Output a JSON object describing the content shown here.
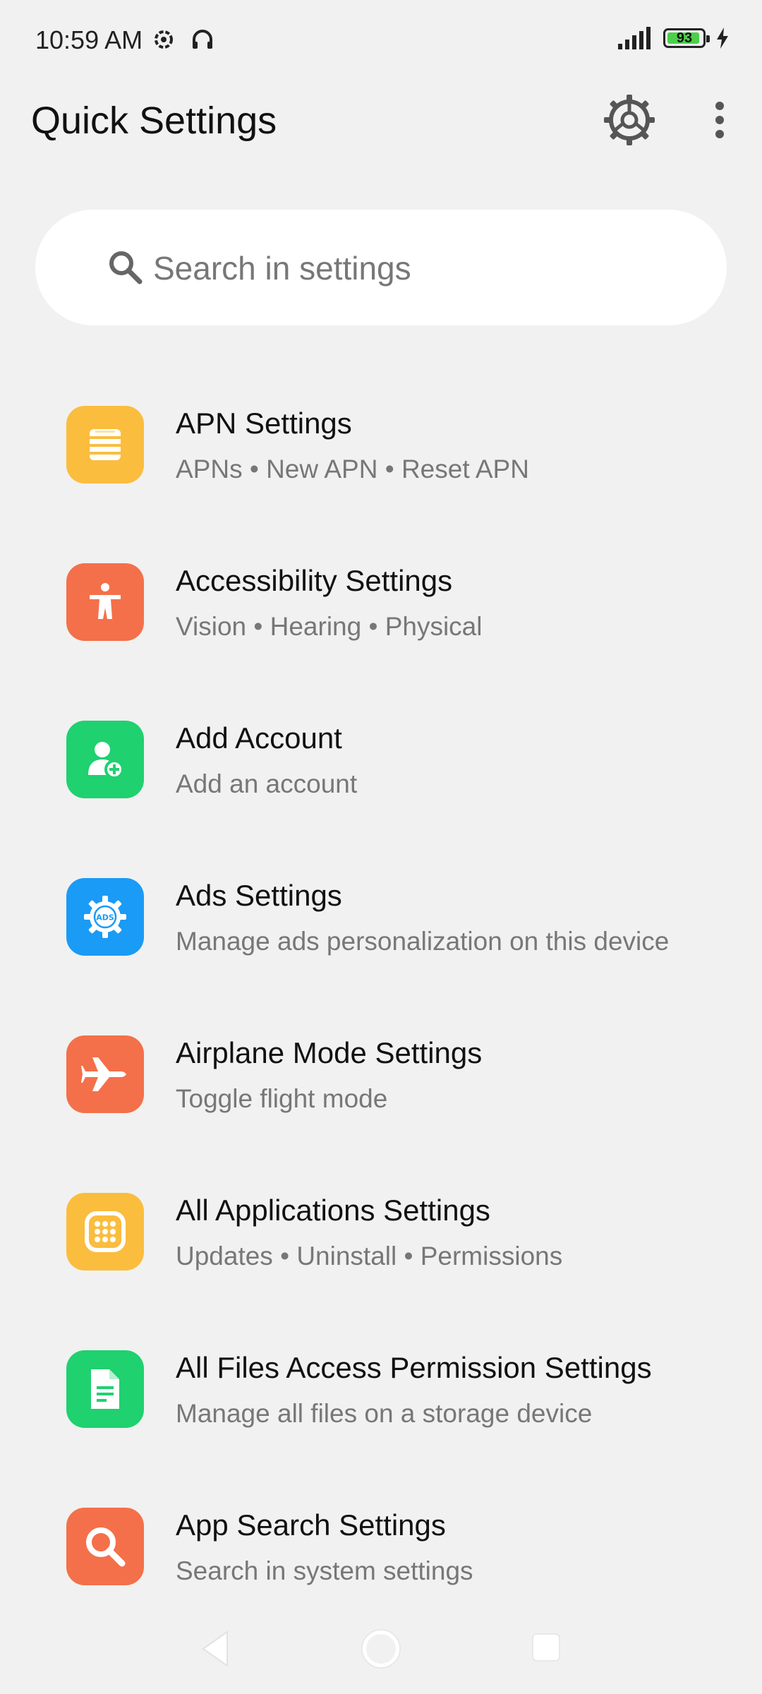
{
  "status_bar": {
    "time": "10:59 AM",
    "battery_level": "93",
    "battery_percent": 93
  },
  "header": {
    "title": "Quick Settings"
  },
  "search": {
    "placeholder": "Search in settings"
  },
  "colors": {
    "background": "#f1f1f1",
    "search_bg": "#ffffff",
    "yellow": "#fbbd3e",
    "orange": "#f4704a",
    "green": "#1fd16f",
    "blue": "#1a9bf6",
    "battery_green": "#4cd04a"
  },
  "items": [
    {
      "title": "APN Settings",
      "subtitle": "APNs • New APN • Reset APN",
      "icon": "apn-list-icon",
      "color": "#fbbd3e"
    },
    {
      "title": "Accessibility Settings",
      "subtitle": "Vision • Hearing • Physical",
      "icon": "accessibility-person-icon",
      "color": "#f4704a"
    },
    {
      "title": "Add Account",
      "subtitle": "Add an account",
      "icon": "add-account-icon",
      "color": "#1fd16f"
    },
    {
      "title": "Ads Settings",
      "subtitle": "Manage ads personalization on this device",
      "icon": "ads-gear-icon",
      "color": "#1a9bf6"
    },
    {
      "title": "Airplane Mode Settings",
      "subtitle": "Toggle flight mode",
      "icon": "airplane-icon",
      "color": "#f4704a"
    },
    {
      "title": "All Applications Settings",
      "subtitle": "Updates • Uninstall • Permissions",
      "icon": "apps-grid-icon",
      "color": "#fbbd3e"
    },
    {
      "title": "All Files Access Permission Settings",
      "subtitle": "Manage all files on a storage device",
      "icon": "file-document-icon",
      "color": "#1fd16f"
    },
    {
      "title": "App Search Settings",
      "subtitle": "Search in system settings",
      "icon": "app-search-icon",
      "color": "#f4704a"
    }
  ],
  "ads_icon_text": "ADS"
}
